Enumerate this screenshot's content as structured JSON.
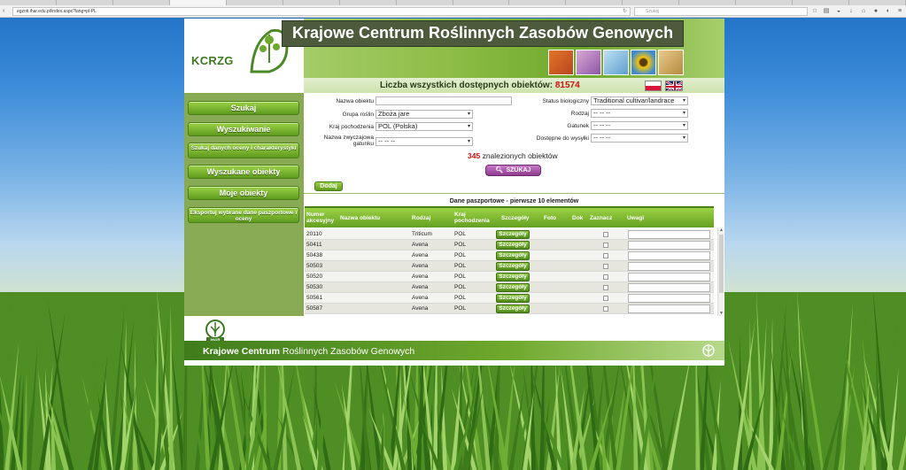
{
  "browser": {
    "tabs": [
      "",
      "",
      "",
      "",
      "",
      "",
      "",
      "",
      "",
      "",
      "",
      "",
      "",
      "",
      "",
      ""
    ],
    "url": "egzoti.ihar.edu.pl/index.aspx?lang=pl-PL",
    "search_placeholder": "Szukaj"
  },
  "header": {
    "logo_text": "KCRZG",
    "site_title": "Krajowe Centrum Roślinnych Zasobów Genowych",
    "count_label": "Liczba wszystkich dostępnych obiektów:",
    "count_value": "81574"
  },
  "sidebar": {
    "items": [
      {
        "label": "Szukaj"
      },
      {
        "label": "Wyszukiwanie"
      },
      {
        "label": "Szukaj danych oceny i charakterystyki"
      },
      {
        "label": "Wyszukane obiekty"
      },
      {
        "label": "Moje obiekty"
      },
      {
        "label": "Eksportuj wybrane dane paszportowe i oceny"
      }
    ]
  },
  "search_form": {
    "object_name": {
      "label": "Nazwa obiektu",
      "value": ""
    },
    "plant_group": {
      "label": "Grupa roślin",
      "value": "Zboża jare"
    },
    "origin_country": {
      "label": "Kraj pochodzenia",
      "value": "POL (Polska)"
    },
    "species_common_name": {
      "label": "Nazwa zwyczajowa gatunku",
      "value": "-- -- --"
    },
    "biological_status": {
      "label": "Status biologiczny",
      "value": "Traditional cultivar/landrace"
    },
    "genus": {
      "label": "Rodzaj",
      "value": "-- -- --"
    },
    "species": {
      "label": "Gatunek",
      "value": "-- -- --"
    },
    "available": {
      "label": "Dostępne do wysyłki",
      "value": "-- -- --"
    },
    "found_count": "345",
    "found_label": "znalezionych obiektów",
    "search_button": "SZUKAJ"
  },
  "results": {
    "add_button": "Dodaj",
    "caption": "Dane paszportowe - pierwsze 10 elementów",
    "columns": [
      "Numer akcesyjny",
      "Nazwa obiektu",
      "Rodzaj",
      "Kraj pochodzenia",
      "Szczegóły",
      "Foto",
      "Dok",
      "Zaznacz",
      "Uwagi"
    ],
    "details_label": "Szczegóły",
    "rows": [
      {
        "accession": "20110",
        "name": "",
        "genus": "Triticum",
        "country": "POL"
      },
      {
        "accession": "50411",
        "name": "",
        "genus": "Avena",
        "country": "POL"
      },
      {
        "accession": "50438",
        "name": "",
        "genus": "Avena",
        "country": "POL"
      },
      {
        "accession": "50503",
        "name": "",
        "genus": "Avena",
        "country": "POL"
      },
      {
        "accession": "50520",
        "name": "",
        "genus": "Avena",
        "country": "POL"
      },
      {
        "accession": "50530",
        "name": "",
        "genus": "Avena",
        "country": "POL"
      },
      {
        "accession": "50561",
        "name": "",
        "genus": "Avena",
        "country": "POL"
      },
      {
        "accession": "50587",
        "name": "",
        "genus": "Avena",
        "country": "POL"
      }
    ]
  },
  "footer": {
    "logo_text": "IHAR",
    "title_bold": "Krajowe Centrum",
    "title_rest": "Roślinnych Zasobów Genowych"
  },
  "colors": {
    "accent_green": "#6ea82c",
    "count_red": "#cc1111",
    "search_button": "#8e3b8e"
  }
}
